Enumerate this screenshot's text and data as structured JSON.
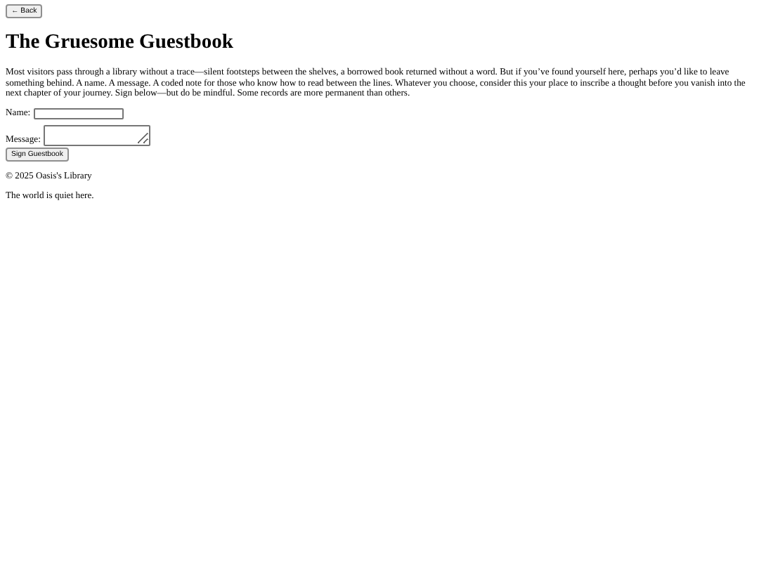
{
  "back_button": {
    "label": "← Back"
  },
  "title": "The Gruesome Guestbook",
  "intro": "Most visitors pass through a library without a trace—silent footsteps between the shelves, a borrowed book returned without a word. But if you’ve found yourself here, perhaps you’d like to leave something behind. A name. A message. A coded note for those who know how to read between the lines. Whatever you choose, consider this your place to inscribe a thought before you vanish into the next chapter of your journey. Sign below—but do be mindful. Some records are more permanent than others.",
  "form": {
    "name_label": "Name:",
    "message_label": "Message:",
    "submit": "Sign Guestbook"
  },
  "footer": "© 2025 Oasis's Library",
  "status": "The world is quiet here."
}
